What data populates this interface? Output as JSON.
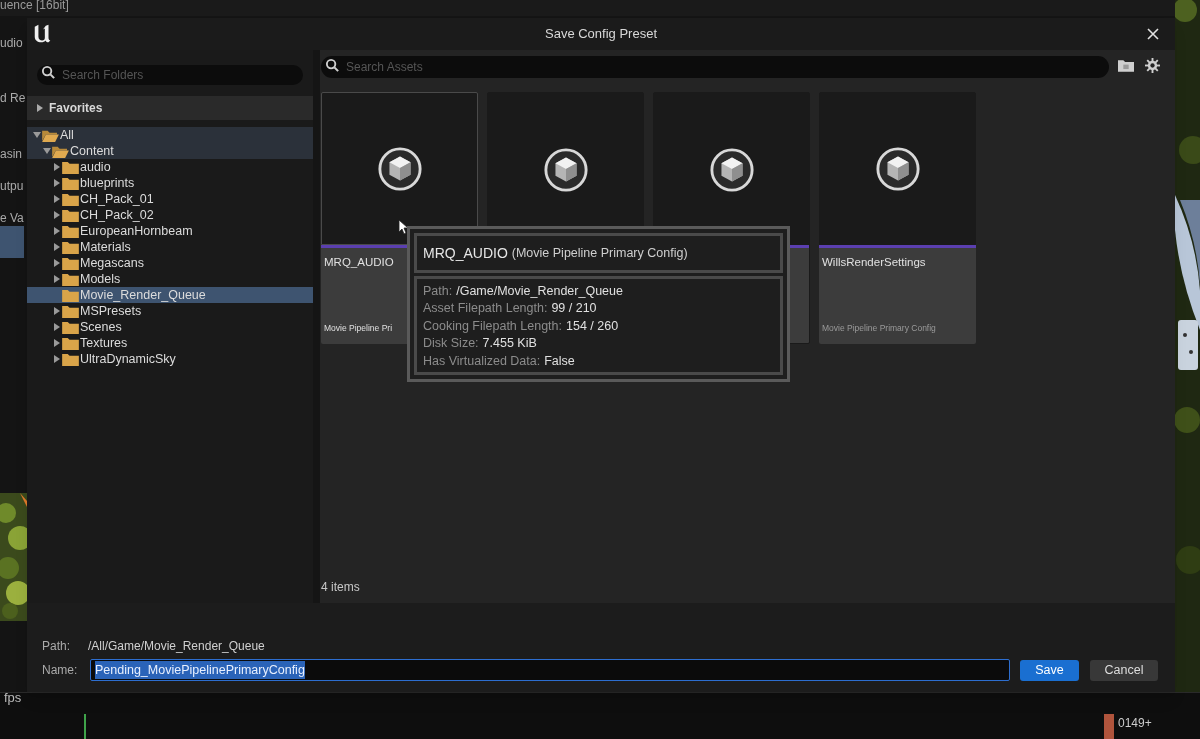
{
  "background": {
    "top_fragment": "uence [16bit]",
    "side_fragments": [
      "udio",
      "d Re",
      "asin",
      "utpu",
      "e Va"
    ],
    "fps_label": "fps",
    "frame_marker": "0149+"
  },
  "window": {
    "title": "Save Config Preset"
  },
  "folder_search": {
    "placeholder": "Search Folders"
  },
  "favorites": {
    "label": "Favorites",
    "expanded": false
  },
  "tree": [
    {
      "label": "All",
      "expanded": true,
      "expandable": true,
      "in_path": true,
      "selected": false,
      "children": [
        {
          "label": "Content",
          "expanded": true,
          "expandable": true,
          "in_path": true,
          "selected": false,
          "children": [
            {
              "label": "audio",
              "expanded": false,
              "expandable": true,
              "in_path": false,
              "selected": false
            },
            {
              "label": "blueprints",
              "expanded": false,
              "expandable": true,
              "in_path": false,
              "selected": false
            },
            {
              "label": "CH_Pack_01",
              "expanded": false,
              "expandable": true,
              "in_path": false,
              "selected": false
            },
            {
              "label": "CH_Pack_02",
              "expanded": false,
              "expandable": true,
              "in_path": false,
              "selected": false
            },
            {
              "label": "EuropeanHornbeam",
              "expanded": false,
              "expandable": true,
              "in_path": false,
              "selected": false
            },
            {
              "label": "Materials",
              "expanded": false,
              "expandable": true,
              "in_path": false,
              "selected": false
            },
            {
              "label": "Megascans",
              "expanded": false,
              "expandable": true,
              "in_path": false,
              "selected": false
            },
            {
              "label": "Models",
              "expanded": false,
              "expandable": true,
              "in_path": false,
              "selected": false
            },
            {
              "label": "Movie_Render_Queue",
              "expanded": false,
              "expandable": false,
              "in_path": false,
              "selected": true
            },
            {
              "label": "MSPresets",
              "expanded": false,
              "expandable": true,
              "in_path": false,
              "selected": false
            },
            {
              "label": "Scenes",
              "expanded": false,
              "expandable": true,
              "in_path": false,
              "selected": false
            },
            {
              "label": "Textures",
              "expanded": false,
              "expandable": true,
              "in_path": false,
              "selected": false
            },
            {
              "label": "UltraDynamicSky",
              "expanded": false,
              "expandable": true,
              "in_path": false,
              "selected": false
            }
          ]
        }
      ]
    }
  ],
  "asset_search": {
    "placeholder": "Search Assets"
  },
  "assets": [
    {
      "name": "MRQ_AUDIO",
      "type": "Movie Pipeline Pri",
      "hovered": true
    },
    {
      "hovered": false
    },
    {
      "hovered": false
    },
    {
      "name": "WillsRenderSettings",
      "type": "Movie Pipeline Primary Config",
      "hovered": false
    }
  ],
  "tooltip": {
    "title": "MRQ_AUDIO",
    "subtitle": "(Movie Pipeline Primary Config)",
    "rows": [
      {
        "label": "Path:",
        "value": "/Game/Movie_Render_Queue"
      },
      {
        "label": "Asset Filepath Length:",
        "value": "99 / 210"
      },
      {
        "label": "Cooking Filepath Length:",
        "value": "154 / 260"
      },
      {
        "label": "Disk Size:",
        "value": "7.455 KiB"
      },
      {
        "label": "Has Virtualized Data:",
        "value": "False"
      }
    ]
  },
  "item_count": "4 items",
  "path": {
    "label": "Path:",
    "value": "/All/Game/Movie_Render_Queue"
  },
  "name": {
    "label": "Name:",
    "value": "Pending_MoviePipelinePrimaryConfig",
    "text_selected": true
  },
  "buttons": [
    {
      "label": "Save",
      "kind": "primary"
    },
    {
      "label": "Cancel",
      "kind": "secondary"
    }
  ]
}
